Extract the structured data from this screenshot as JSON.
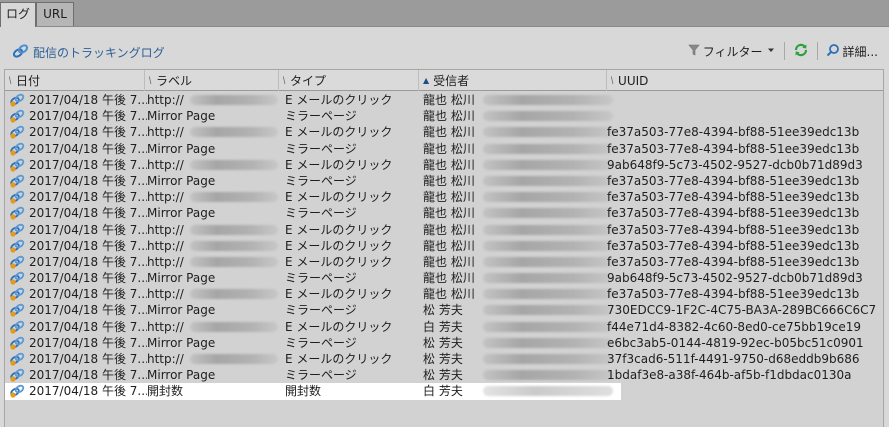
{
  "tabs": [
    {
      "label": "ログ",
      "active": true
    },
    {
      "label": "URL",
      "active": false
    }
  ],
  "toolbar": {
    "title": "配信のトラッキングログ",
    "filter_label": "フィルター",
    "detail_label": "詳細..."
  },
  "columns": {
    "date": "日付",
    "label": "ラベル",
    "type": "タイプ",
    "recipient": "受信者",
    "uuid": "UUID"
  },
  "rows": [
    {
      "date": "2017/04/18 午後 7...",
      "label": "http://",
      "type": "E メールのクリック",
      "recipient": "龍也 松川",
      "uuid": ""
    },
    {
      "date": "2017/04/18 午後 7...",
      "label": "Mirror Page",
      "type": "ミラーページ",
      "recipient": "龍也 松川",
      "uuid": ""
    },
    {
      "date": "2017/04/18 午後 7...",
      "label": "http://",
      "type": "E メールのクリック",
      "recipient": "龍也 松川",
      "uuid": "fe37a503-77e8-4394-bf88-51ee39edc13b"
    },
    {
      "date": "2017/04/18 午後 7...",
      "label": "Mirror Page",
      "type": "ミラーページ",
      "recipient": "龍也 松川",
      "uuid": "fe37a503-77e8-4394-bf88-51ee39edc13b"
    },
    {
      "date": "2017/04/18 午後 7...",
      "label": "http://",
      "type": "E メールのクリック",
      "recipient": "龍也 松川",
      "uuid": "9ab648f9-5c73-4502-9527-dcb0b71d89d3"
    },
    {
      "date": "2017/04/18 午後 7...",
      "label": "Mirror Page",
      "type": "ミラーページ",
      "recipient": "龍也 松川",
      "uuid": "fe37a503-77e8-4394-bf88-51ee39edc13b"
    },
    {
      "date": "2017/04/18 午後 7...",
      "label": "http://",
      "type": "E メールのクリック",
      "recipient": "龍也 松川",
      "uuid": "fe37a503-77e8-4394-bf88-51ee39edc13b"
    },
    {
      "date": "2017/04/18 午後 7...",
      "label": "Mirror Page",
      "type": "ミラーページ",
      "recipient": "龍也 松川",
      "uuid": "fe37a503-77e8-4394-bf88-51ee39edc13b"
    },
    {
      "date": "2017/04/18 午後 7...",
      "label": "http://",
      "type": "E メールのクリック",
      "recipient": "龍也 松川",
      "uuid": "fe37a503-77e8-4394-bf88-51ee39edc13b"
    },
    {
      "date": "2017/04/18 午後 7...",
      "label": "http://",
      "type": "E メールのクリック",
      "recipient": "龍也 松川",
      "uuid": "fe37a503-77e8-4394-bf88-51ee39edc13b"
    },
    {
      "date": "2017/04/18 午後 7...",
      "label": "http://",
      "type": "E メールのクリック",
      "recipient": "龍也 松川",
      "uuid": "fe37a503-77e8-4394-bf88-51ee39edc13b"
    },
    {
      "date": "2017/04/18 午後 7...",
      "label": "Mirror Page",
      "type": "ミラーページ",
      "recipient": "龍也 松川",
      "uuid": "9ab648f9-5c73-4502-9527-dcb0b71d89d3"
    },
    {
      "date": "2017/04/18 午後 7...",
      "label": "http://",
      "type": "E メールのクリック",
      "recipient": "龍也 松川",
      "uuid": "fe37a503-77e8-4394-bf88-51ee39edc13b"
    },
    {
      "date": "2017/04/18 午後 7...",
      "label": "Mirror Page",
      "type": "ミラーページ",
      "recipient": "松 芳夫",
      "uuid": "730EDCC9-1F2C-4C75-BA3A-289BC666C6C7"
    },
    {
      "date": "2017/04/18 午後 7...",
      "label": "http://",
      "type": "E メールのクリック",
      "recipient": "白 芳夫",
      "uuid": "f44e71d4-8382-4c60-8ed0-ce75bb19ce19"
    },
    {
      "date": "2017/04/18 午後 7...",
      "label": "Mirror Page",
      "type": "ミラーページ",
      "recipient": "松 芳夫",
      "uuid": "e6bc3ab5-0144-4819-92ec-b05bc51c0901"
    },
    {
      "date": "2017/04/18 午後 7...",
      "label": "http://",
      "type": "E メールのクリック",
      "recipient": "松 芳夫",
      "uuid": "37f3cad6-511f-4491-9750-d68eddb9b686"
    },
    {
      "date": "2017/04/18 午後 7...",
      "label": "Mirror Page",
      "type": "ミラーページ",
      "recipient": "松 芳夫",
      "uuid": "1bdaf3e8-a38f-464b-af5b-f1dbdac0130a"
    },
    {
      "date": "2017/04/18 午後 7...",
      "label": "開封数",
      "type": "開封数",
      "recipient": "白 芳夫",
      "uuid": ""
    }
  ],
  "selected_row": 18,
  "icons": {
    "tracking": "tracking-link-icon",
    "filter": "funnel-icon",
    "refresh": "refresh-icon",
    "search": "magnifier-icon",
    "row": "tracking-event-icon"
  },
  "colors": {
    "accent": "#2d5f96",
    "refresh": "#2aa13a",
    "selected_row": "#ffffff",
    "background": "#d8d8d8"
  }
}
